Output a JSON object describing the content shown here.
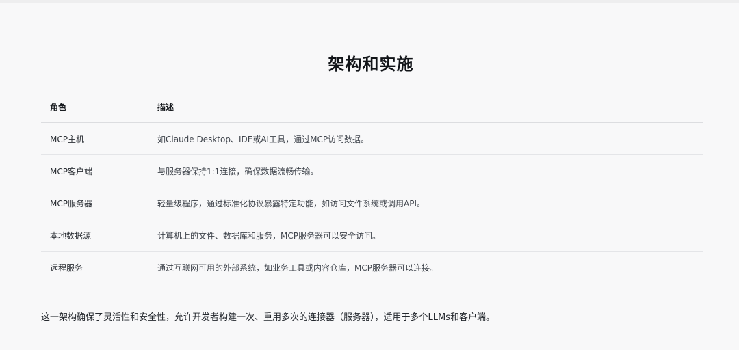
{
  "article": {
    "title": "架构和实施",
    "table": {
      "headers": [
        "角色",
        "描述"
      ],
      "rows": [
        {
          "role": "MCP主机",
          "description": "如Claude Desktop、IDE或AI工具，通过MCP访问数据。"
        },
        {
          "role": "MCP客户端",
          "description": "与服务器保持1:1连接，确保数据流畅传输。"
        },
        {
          "role": "MCP服务器",
          "description": "轻量级程序，通过标准化协议暴露特定功能，如访问文件系统或调用API。"
        },
        {
          "role": "本地数据源",
          "description": "计算机上的文件、数据库和服务，MCP服务器可以安全访问。"
        },
        {
          "role": "远程服务",
          "description": "通过互联网可用的外部系统，如业务工具或内容仓库，MCP服务器可以连接。"
        }
      ]
    },
    "footer": "这一架构确保了灵活性和安全性，允许开发者构建一次、重用多次的连接器（服务器），适用于多个LLMs和客户端。"
  }
}
